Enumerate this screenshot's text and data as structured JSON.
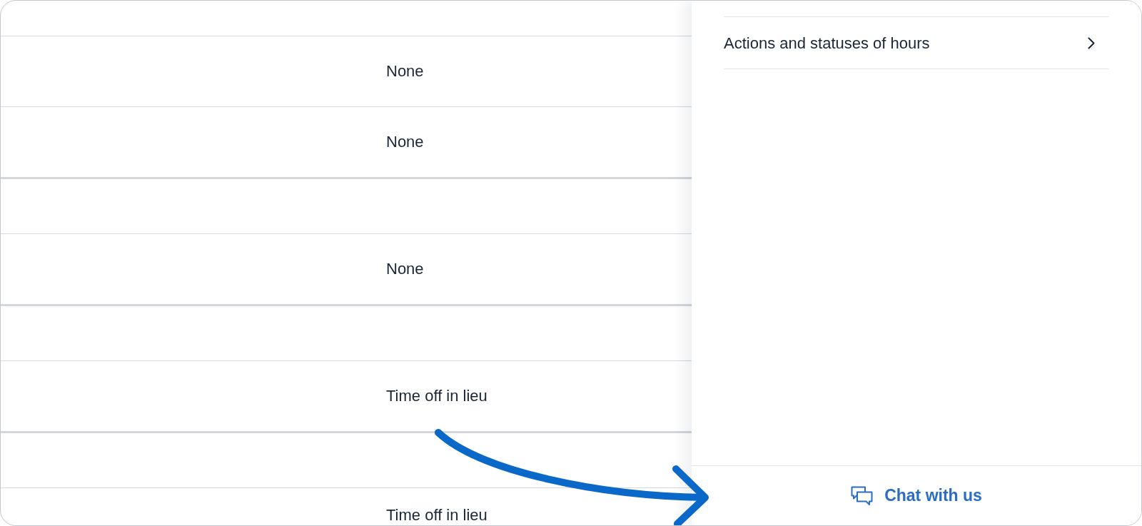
{
  "table": {
    "rows": [
      {
        "kind": "group"
      },
      {
        "kind": "entry",
        "text": "None"
      },
      {
        "kind": "entry",
        "text": "None"
      },
      {
        "kind": "group"
      },
      {
        "kind": "entry",
        "text": "None"
      },
      {
        "kind": "group"
      },
      {
        "kind": "entry",
        "text": "Time off in lieu"
      },
      {
        "kind": "group"
      },
      {
        "kind": "entry",
        "text": "Time off in lieu"
      }
    ]
  },
  "side_panel": {
    "items": [
      {
        "label": "Actions and statuses of hours"
      }
    ],
    "chat_button": {
      "label": "Chat with us"
    }
  }
}
